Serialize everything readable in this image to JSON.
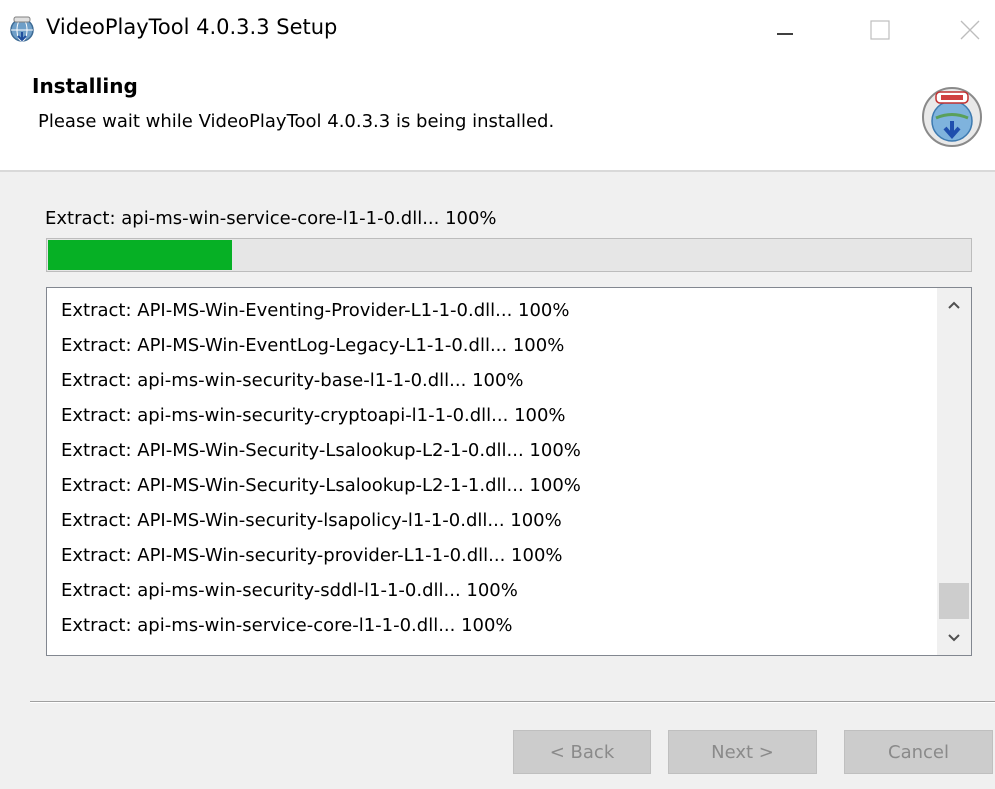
{
  "window": {
    "title": "VideoPlayTool 4.0.3.3 Setup",
    "icon": "installer-globe-icon"
  },
  "header": {
    "title": "Installing",
    "subtitle": "Please wait while VideoPlayTool 4.0.3.3 is being installed.",
    "logo": "nsis-installer-logo-icon"
  },
  "progress": {
    "status": "Extract: api-ms-win-service-core-l1-1-0.dll... 100%",
    "percent": 20,
    "color": "#06b025"
  },
  "log": {
    "lines": [
      "Extract: API-MS-Win-Eventing-Provider-L1-1-0.dll... 100%",
      "Extract: API-MS-Win-EventLog-Legacy-L1-1-0.dll... 100%",
      "Extract: api-ms-win-security-base-l1-1-0.dll... 100%",
      "Extract: api-ms-win-security-cryptoapi-l1-1-0.dll... 100%",
      "Extract: API-MS-Win-Security-Lsalookup-L2-1-0.dll... 100%",
      "Extract: API-MS-Win-Security-Lsalookup-L2-1-1.dll... 100%",
      "Extract: API-MS-Win-security-lsapolicy-l1-1-0.dll... 100%",
      "Extract: API-MS-Win-security-provider-L1-1-0.dll... 100%",
      "Extract: api-ms-win-security-sddl-l1-1-0.dll... 100%",
      "Extract: api-ms-win-service-core-l1-1-0.dll... 100%"
    ]
  },
  "buttons": {
    "back": "< Back",
    "next": "Next >",
    "cancel": "Cancel"
  }
}
